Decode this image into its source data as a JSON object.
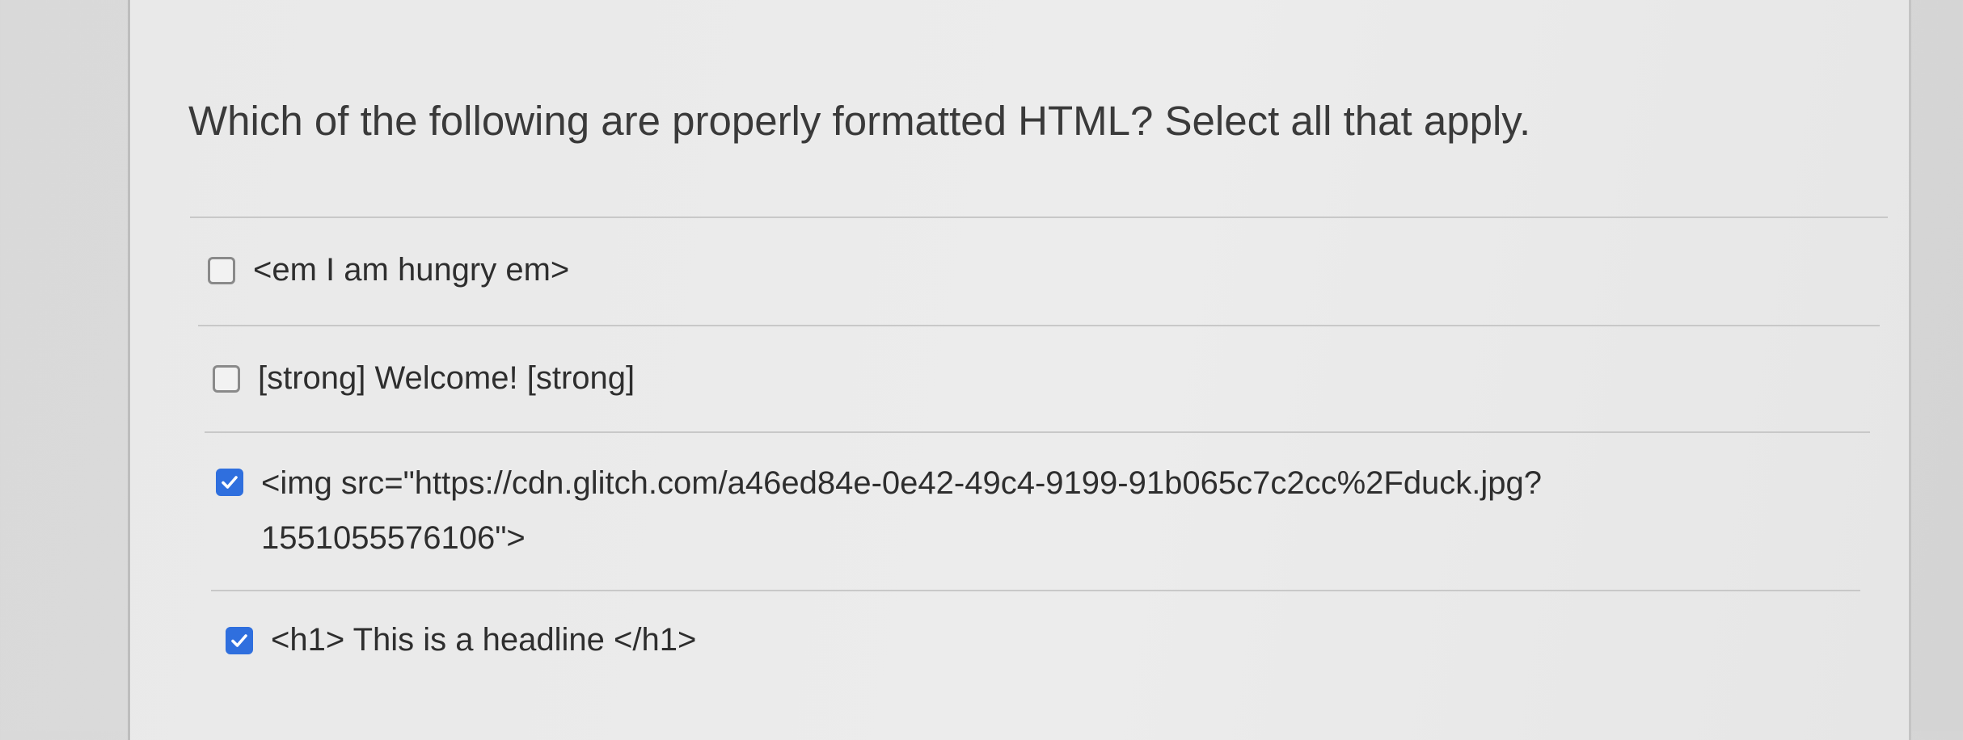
{
  "question": {
    "text": "Which of the following are properly formatted HTML? Select all that apply."
  },
  "options": [
    {
      "text": "<em I am hungry em>",
      "checked": false
    },
    {
      "text": "[strong] Welcome! [strong]",
      "checked": false
    },
    {
      "text_line1": "<img src=\"https://cdn.glitch.com/a46ed84e-0e42-49c4-9199-91b065c7c2cc%2Fduck.jpg?",
      "text_line2": "1551055576106\">",
      "checked": true
    },
    {
      "text": "<h1> This is a headline </h1>",
      "checked": true
    }
  ],
  "colors": {
    "checkbox_checked": "#2f6fde",
    "checkbox_unchecked_border": "#8a8a8a",
    "text": "#2e2e2e"
  },
  "icons": {
    "checked": "checkmark-icon"
  }
}
